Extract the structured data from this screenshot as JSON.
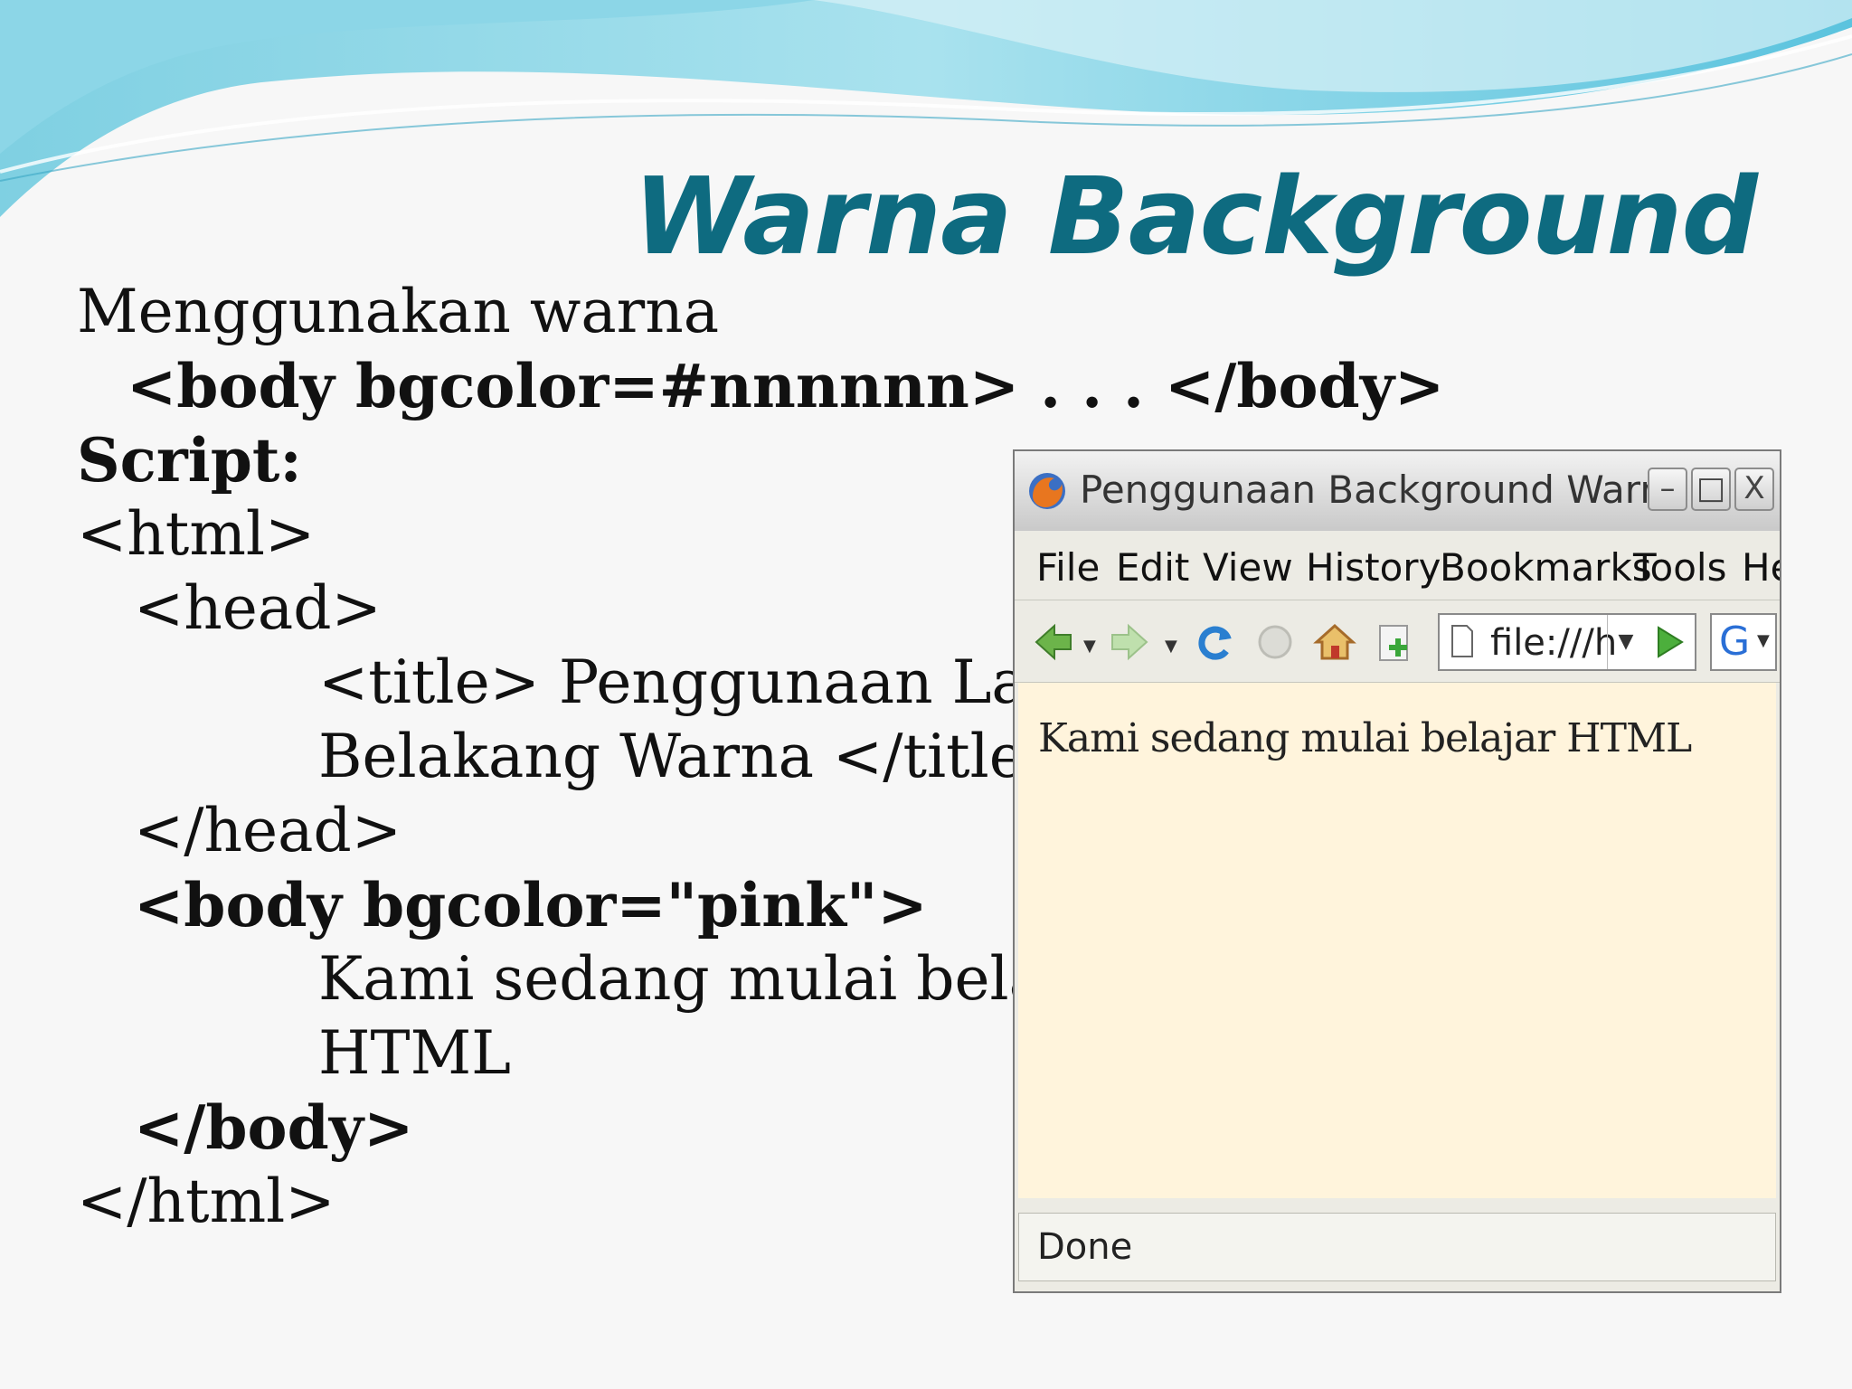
{
  "slide": {
    "title": "Warna Background",
    "lines": [
      "Menggunakan warna",
      "<body bgcolor=#nnnnnn> . . . </body>",
      "Script:",
      "<html>",
      "<head>",
      "<title> Penggunaan Lata",
      "Belakang Warna </title>",
      "</head>",
      "<body bgcolor=\"pink\">",
      "Kami sedang mulai bela",
      "HTML",
      "</body>",
      "</html>"
    ]
  },
  "browser": {
    "window_title": "Penggunaan Background Warna -",
    "buttons": {
      "minimize": "–",
      "maximize": "□",
      "close": "X"
    },
    "menu": [
      "File",
      "Edit",
      "View",
      "History",
      "Bookmarks",
      "Tools",
      "He"
    ],
    "toolbar": {
      "icons": [
        "back-icon",
        "forward-icon",
        "reload-icon",
        "stop-icon",
        "home-icon",
        "bookmark-add-icon",
        "page-icon",
        "go-icon",
        "google-icon"
      ],
      "url": "file:///h",
      "search_label": "G"
    },
    "content_text": "Kami sedang mulai belajar HTML",
    "content_bg": "#fff4dc",
    "status": "Done"
  },
  "colors": {
    "title": "#0e6b80",
    "wave": "#59c4dc"
  }
}
